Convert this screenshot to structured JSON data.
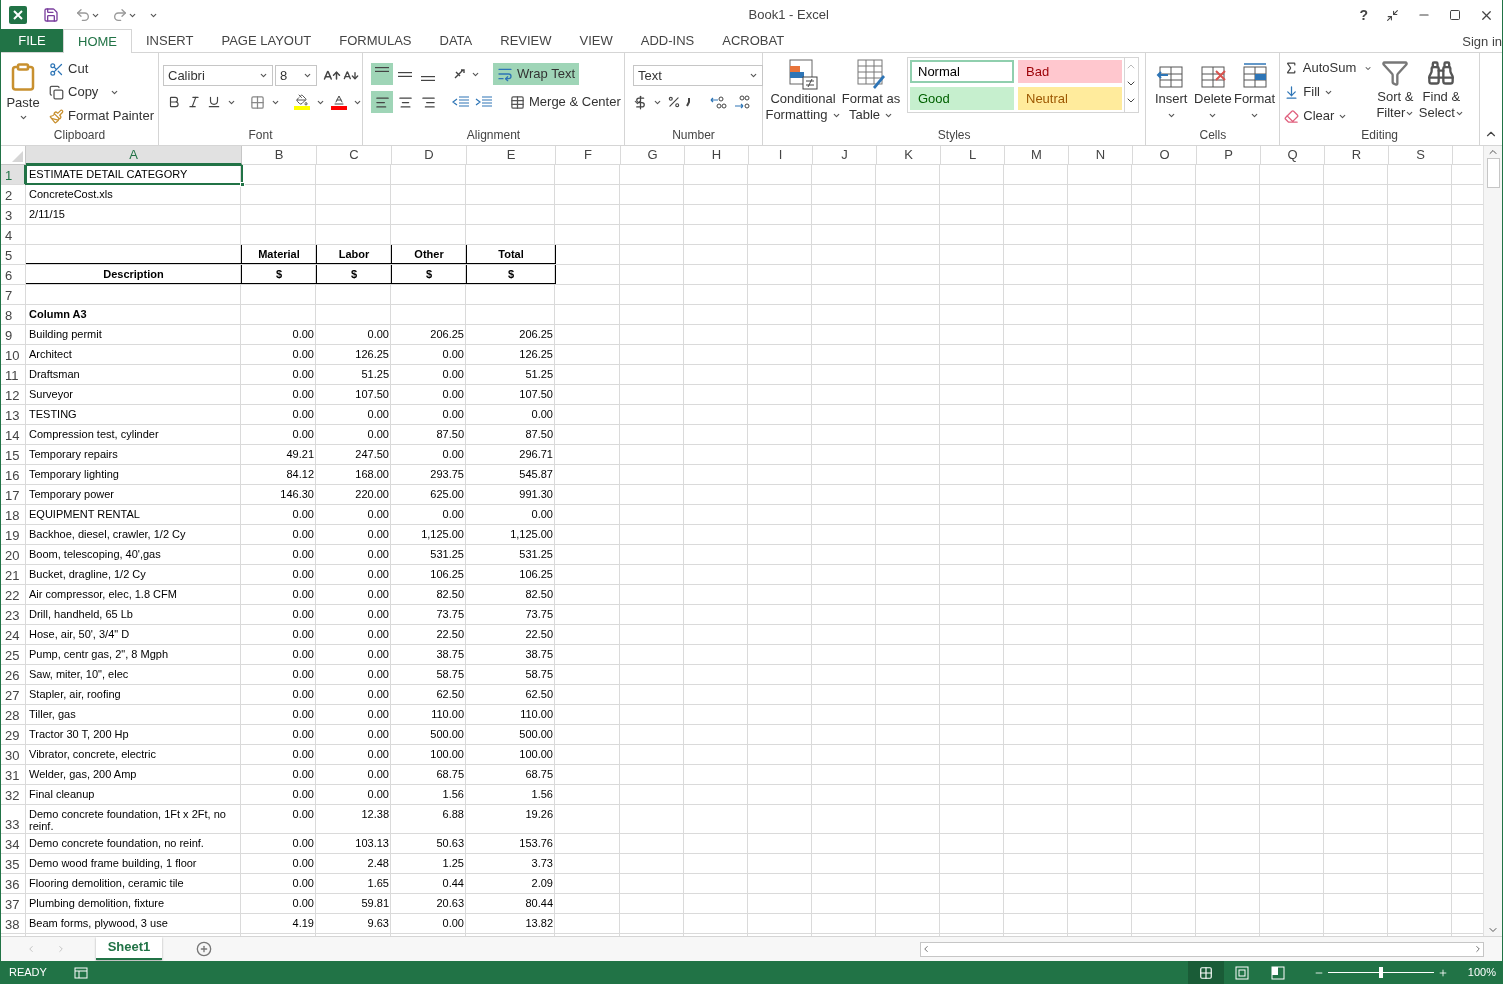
{
  "window": {
    "title": "Book1 - Excel",
    "help": "?"
  },
  "tabs": [
    {
      "label": "FILE",
      "kind": "file",
      "selected": false
    },
    {
      "label": "HOME",
      "kind": "tab",
      "selected": true
    },
    {
      "label": "INSERT",
      "kind": "tab",
      "selected": false
    },
    {
      "label": "PAGE LAYOUT",
      "kind": "tab",
      "selected": false
    },
    {
      "label": "FORMULAS",
      "kind": "tab",
      "selected": false
    },
    {
      "label": "DATA",
      "kind": "tab",
      "selected": false
    },
    {
      "label": "REVIEW",
      "kind": "tab",
      "selected": false
    },
    {
      "label": "VIEW",
      "kind": "tab",
      "selected": false
    },
    {
      "label": "ADD-INS",
      "kind": "tab",
      "selected": false
    },
    {
      "label": "ACROBAT",
      "kind": "tab",
      "selected": false
    }
  ],
  "sign_in": "Sign in",
  "ribbon": {
    "clipboard": {
      "label": "Clipboard",
      "paste": "Paste",
      "cut": "Cut",
      "copy": "Copy",
      "format_painter": "Format Painter"
    },
    "font": {
      "label": "Font",
      "name": "Calibri",
      "size": "8"
    },
    "alignment": {
      "label": "Alignment",
      "vertical": [
        {
          "selected": true
        },
        {
          "selected": false
        },
        {
          "selected": false
        }
      ],
      "horizontal": [
        {
          "selected": true
        },
        {
          "selected": false
        },
        {
          "selected": false
        }
      ],
      "wrap_text": {
        "label": "Wrap Text",
        "selected": true
      },
      "merge": "Merge & Center"
    },
    "number": {
      "label": "Number",
      "format": "Text"
    },
    "styles": {
      "label": "Styles",
      "conditional": [
        "Conditional",
        "Formatting"
      ],
      "format_table": [
        "Format as",
        "Table"
      ],
      "gallery": [
        {
          "label": "Normal",
          "kind": "normal",
          "selected": true
        },
        {
          "label": "Bad",
          "kind": "bad",
          "selected": false
        },
        {
          "label": "Good",
          "kind": "good",
          "selected": false
        },
        {
          "label": "Neutral",
          "kind": "neutral",
          "selected": false
        }
      ]
    },
    "cells": {
      "label": "Cells",
      "buttons": [
        {
          "label": "Insert",
          "kind": "insert"
        },
        {
          "label": "Delete",
          "kind": "delete"
        },
        {
          "label": "Format",
          "kind": "format"
        }
      ]
    },
    "editing": {
      "label": "Editing",
      "autosum": "AutoSum",
      "fill": "Fill",
      "clear": "Clear",
      "sort": [
        "Sort &",
        "Filter"
      ],
      "find": [
        "Find &",
        "Select"
      ]
    }
  },
  "sheet": {
    "columns": [
      {
        "label": "A",
        "selected": true
      },
      {
        "label": "B",
        "selected": false
      },
      {
        "label": "C",
        "selected": false
      },
      {
        "label": "D",
        "selected": false
      },
      {
        "label": "E",
        "selected": false
      },
      {
        "label": "F",
        "selected": false
      },
      {
        "label": "G",
        "selected": false
      },
      {
        "label": "H",
        "selected": false
      },
      {
        "label": "I",
        "selected": false
      },
      {
        "label": "J",
        "selected": false
      },
      {
        "label": "K",
        "selected": false
      },
      {
        "label": "L",
        "selected": false
      },
      {
        "label": "M",
        "selected": false
      },
      {
        "label": "N",
        "selected": false
      },
      {
        "label": "O",
        "selected": false
      },
      {
        "label": "P",
        "selected": false
      },
      {
        "label": "Q",
        "selected": false
      },
      {
        "label": "R",
        "selected": false
      },
      {
        "label": "S",
        "selected": false
      }
    ],
    "rows": [
      {
        "n": "1",
        "kind": "text",
        "selected": true,
        "cells": [
          "ESTIMATE DETAIL CATEGORY"
        ]
      },
      {
        "n": "2",
        "kind": "text",
        "selected": false,
        "cells": [
          "ConcreteCost.xls"
        ]
      },
      {
        "n": "3",
        "kind": "text",
        "selected": false,
        "cells": [
          "2/11/15"
        ]
      },
      {
        "n": "4",
        "kind": "blank",
        "selected": false
      },
      {
        "n": "5",
        "kind": "header_top",
        "selected": false,
        "cells": [
          "Material",
          "Labor",
          "Other",
          "Total"
        ]
      },
      {
        "n": "6",
        "kind": "header",
        "selected": false,
        "cells": [
          "Description",
          "$",
          "$",
          "$",
          "$"
        ]
      },
      {
        "n": "7",
        "kind": "blank",
        "selected": false
      },
      {
        "n": "8",
        "kind": "section",
        "selected": false,
        "cells": [
          "Column A3"
        ]
      },
      {
        "n": "9",
        "kind": "item",
        "selected": false,
        "cells": [
          "Building permit",
          "0.00",
          "0.00",
          "206.25",
          "206.25"
        ]
      },
      {
        "n": "10",
        "kind": "item",
        "selected": false,
        "cells": [
          "Architect",
          "0.00",
          "126.25",
          "0.00",
          "126.25"
        ]
      },
      {
        "n": "11",
        "kind": "item",
        "selected": false,
        "cells": [
          "Draftsman",
          "0.00",
          "51.25",
          "0.00",
          "51.25"
        ]
      },
      {
        "n": "12",
        "kind": "item",
        "selected": false,
        "cells": [
          "Surveyor",
          "0.00",
          "107.50",
          "0.00",
          "107.50"
        ]
      },
      {
        "n": "13",
        "kind": "item",
        "selected": false,
        "cells": [
          "TESTING",
          "0.00",
          "0.00",
          "0.00",
          "0.00"
        ]
      },
      {
        "n": "14",
        "kind": "item",
        "selected": false,
        "cells": [
          "Compression test, cylinder",
          "0.00",
          "0.00",
          "87.50",
          "87.50"
        ]
      },
      {
        "n": "15",
        "kind": "item",
        "selected": false,
        "cells": [
          "Temporary repairs",
          "49.21",
          "247.50",
          "0.00",
          "296.71"
        ]
      },
      {
        "n": "16",
        "kind": "item",
        "selected": false,
        "cells": [
          "Temporary lighting",
          "84.12",
          "168.00",
          "293.75",
          "545.87"
        ]
      },
      {
        "n": "17",
        "kind": "item",
        "selected": false,
        "cells": [
          "Temporary power",
          "146.30",
          "220.00",
          "625.00",
          "991.30"
        ]
      },
      {
        "n": "18",
        "kind": "item",
        "selected": false,
        "cells": [
          "EQUIPMENT RENTAL",
          "0.00",
          "0.00",
          "0.00",
          "0.00"
        ]
      },
      {
        "n": "19",
        "kind": "item",
        "selected": false,
        "cells": [
          "Backhoe, diesel, crawler, 1/2 Cy",
          "0.00",
          "0.00",
          "1,125.00",
          "1,125.00"
        ]
      },
      {
        "n": "20",
        "kind": "item",
        "selected": false,
        "cells": [
          "Boom, telescoping, 40',gas",
          "0.00",
          "0.00",
          "531.25",
          "531.25"
        ]
      },
      {
        "n": "21",
        "kind": "item",
        "selected": false,
        "cells": [
          "Bucket, dragline, 1/2 Cy",
          "0.00",
          "0.00",
          "106.25",
          "106.25"
        ]
      },
      {
        "n": "22",
        "kind": "item",
        "selected": false,
        "cells": [
          "Air compressor, elec, 1.8 CFM",
          "0.00",
          "0.00",
          "82.50",
          "82.50"
        ]
      },
      {
        "n": "23",
        "kind": "item",
        "selected": false,
        "cells": [
          "Drill, handheld, 65 Lb",
          "0.00",
          "0.00",
          "73.75",
          "73.75"
        ]
      },
      {
        "n": "24",
        "kind": "item",
        "selected": false,
        "cells": [
          "Hose, air, 50', 3/4\" D",
          "0.00",
          "0.00",
          "22.50",
          "22.50"
        ]
      },
      {
        "n": "25",
        "kind": "item",
        "selected": false,
        "cells": [
          "Pump, centr gas, 2\", 8 Mgph",
          "0.00",
          "0.00",
          "38.75",
          "38.75"
        ]
      },
      {
        "n": "26",
        "kind": "item",
        "selected": false,
        "cells": [
          "Saw, miter, 10\", elec",
          "0.00",
          "0.00",
          "58.75",
          "58.75"
        ]
      },
      {
        "n": "27",
        "kind": "item",
        "selected": false,
        "cells": [
          "Stapler, air, roofing",
          "0.00",
          "0.00",
          "62.50",
          "62.50"
        ]
      },
      {
        "n": "28",
        "kind": "item",
        "selected": false,
        "cells": [
          "Tiller, gas",
          "0.00",
          "0.00",
          "110.00",
          "110.00"
        ]
      },
      {
        "n": "29",
        "kind": "item",
        "selected": false,
        "cells": [
          "Tractor 30 T, 200 Hp",
          "0.00",
          "0.00",
          "500.00",
          "500.00"
        ]
      },
      {
        "n": "30",
        "kind": "item",
        "selected": false,
        "cells": [
          "Vibrator, concrete, electric",
          "0.00",
          "0.00",
          "100.00",
          "100.00"
        ]
      },
      {
        "n": "31",
        "kind": "item",
        "selected": false,
        "cells": [
          "Welder, gas, 200 Amp",
          "0.00",
          "0.00",
          "68.75",
          "68.75"
        ]
      },
      {
        "n": "32",
        "kind": "item",
        "selected": false,
        "cells": [
          "Final cleanup",
          "0.00",
          "0.00",
          "1.56",
          "1.56"
        ]
      },
      {
        "n": "33",
        "kind": "item",
        "selected": false,
        "cells": [
          "Demo concrete foundation, 1Ft x 2Ft, no reinf.",
          "0.00",
          "12.38",
          "6.88",
          "19.26"
        ]
      },
      {
        "n": "34",
        "kind": "item",
        "selected": false,
        "cells": [
          "Demo concrete foundation, no reinf.",
          "0.00",
          "103.13",
          "50.63",
          "153.76"
        ]
      },
      {
        "n": "35",
        "kind": "item",
        "selected": false,
        "cells": [
          "Demo wood frame building, 1 floor",
          "0.00",
          "2.48",
          "1.25",
          "3.73"
        ]
      },
      {
        "n": "36",
        "kind": "item",
        "selected": false,
        "cells": [
          "Flooring demolition, ceramic tile",
          "0.00",
          "1.65",
          "0.44",
          "2.09"
        ]
      },
      {
        "n": "37",
        "kind": "item",
        "selected": false,
        "cells": [
          "Plumbing demolition, fixture",
          "0.00",
          "59.81",
          "20.63",
          "80.44"
        ]
      },
      {
        "n": "38",
        "kind": "item",
        "selected": false,
        "cells": [
          "Beam forms, plywood, 3 use",
          "4.19",
          "9.63",
          "0.00",
          "13.82"
        ]
      }
    ]
  },
  "sheet_tabs": [
    {
      "label": "Sheet1",
      "selected": true
    }
  ],
  "status_bar": {
    "mode": "READY",
    "views": [
      {
        "kind": "normal",
        "selected": true
      },
      {
        "kind": "page_layout",
        "selected": false
      },
      {
        "kind": "page_break",
        "selected": false
      }
    ],
    "zoom": {
      "level": 0.5,
      "reading": "100%"
    }
  }
}
